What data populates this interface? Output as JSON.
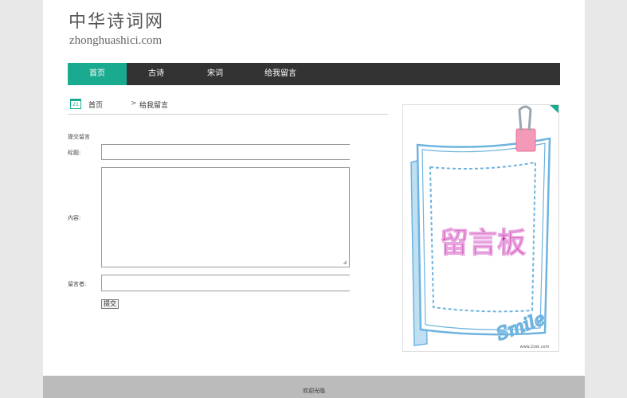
{
  "header": {
    "title": "中华诗词网",
    "subtitle": "zhonghuashici.com"
  },
  "nav": {
    "items": [
      {
        "label": "首页",
        "active": true
      },
      {
        "label": "古诗",
        "active": false
      },
      {
        "label": "宋词",
        "active": false
      },
      {
        "label": "给我留言",
        "active": false
      }
    ]
  },
  "breadcrumb": {
    "calendar_day": "21",
    "home": "首页",
    "separator": ">",
    "current": "给我留言"
  },
  "form": {
    "heading": "提交留言",
    "title_label": "标题:",
    "title_value": "",
    "content_label": "内容:",
    "content_value": "",
    "author_label": "留言者:",
    "author_value": "",
    "submit_label": "提交"
  },
  "side_image": {
    "text": "留言板",
    "smile_text": "Smile",
    "watermark": "www.2zsk.com"
  },
  "footer": {
    "text": "欢迎光临"
  },
  "colors": {
    "accent": "#1aaa8f",
    "nav_bg": "#333333",
    "footer_bg": "#bbbbbb",
    "board_text": "#c8209b",
    "board_frame": "#6fb3df"
  }
}
